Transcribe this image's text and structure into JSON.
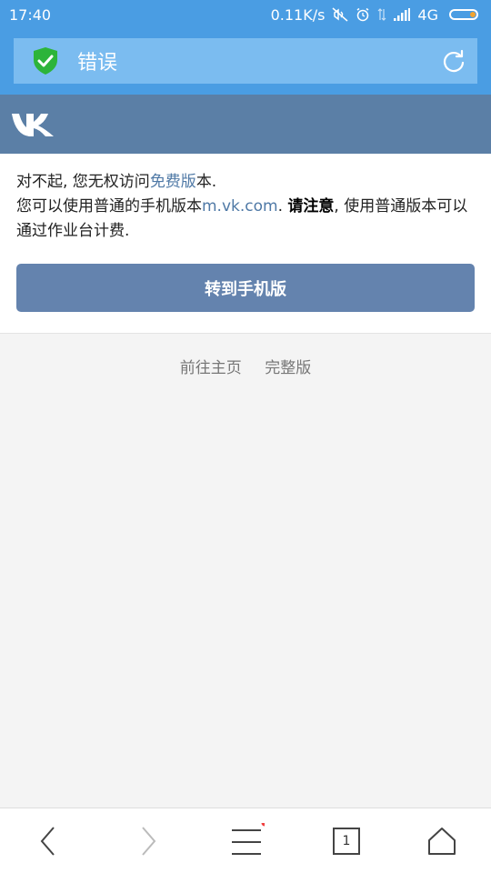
{
  "status_bar": {
    "time": "17:40",
    "net_speed": "0.11K/s",
    "network_type": "4G",
    "icons": [
      "mute-icon",
      "alarm-icon",
      "data-arrows-icon",
      "signal-icon",
      "battery-icon"
    ]
  },
  "browser": {
    "page_title": "错误",
    "security_icon": "shield-check-icon",
    "reload_icon": "reload-icon"
  },
  "vk": {
    "logo": "vk-logo"
  },
  "message": {
    "line1_prefix": "对不起, 您无权访问",
    "line1_link": "免费版",
    "line1_suffix": "本.",
    "line2_prefix": "您可以使用普通的手机版本",
    "line2_link": "m.vk.com",
    "line2_mid": ". ",
    "line2_bold": "请注意",
    "line2_suffix": ", 使用普通版本可以通过作业台计费."
  },
  "mobile_button": {
    "label": "转到手机版"
  },
  "footer": {
    "home_link": "前往主页",
    "full_version_link": "完整版"
  },
  "bottom_nav": {
    "tab_count": "1",
    "items": [
      "back-icon",
      "forward-icon",
      "menu-icon",
      "tabs-icon",
      "home-icon"
    ]
  },
  "colors": {
    "browser_blue": "#4a9de3",
    "vk_header": "#5b7fa6",
    "button": "#6483ae",
    "link": "#4f79a6",
    "notification_dot": "#f04040"
  }
}
